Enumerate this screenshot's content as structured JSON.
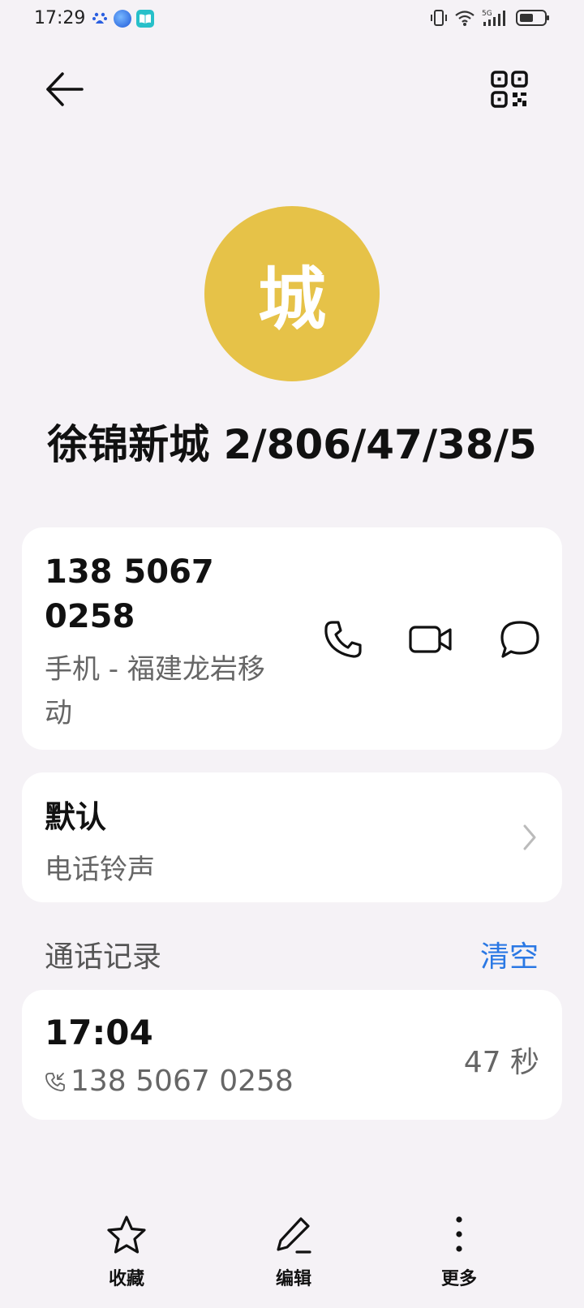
{
  "status_bar": {
    "time": "17:29",
    "app_icons": [
      "baidu-icon",
      "browser-icon",
      "book-icon"
    ],
    "right_icons": [
      "vibrate-icon",
      "wifi-icon",
      "signal-5g-icon",
      "battery-icon"
    ],
    "network_label": "5G"
  },
  "header": {
    "back_icon": "arrow-left-icon",
    "qr_icon": "qr-code-icon"
  },
  "contact": {
    "avatar_letter": "城",
    "avatar_color": "#e6c248",
    "name": "徐锦新城 2/806/47/38/5"
  },
  "phone_card": {
    "number": "138 5067 0258",
    "type_label": "手机 - 福建龙岩移动",
    "actions": [
      "phone-call-icon",
      "video-call-icon",
      "message-icon"
    ]
  },
  "ringtone_card": {
    "title": "默认",
    "subtitle": "电话铃声"
  },
  "call_log": {
    "section_title": "通话记录",
    "clear_label": "清空",
    "accent_color": "#2a78e4",
    "entries": [
      {
        "time": "17:04",
        "number": "138 5067 0258",
        "duration": "47 秒"
      }
    ]
  },
  "bottom_nav": {
    "items": [
      {
        "label": "收藏",
        "icon": "star-icon"
      },
      {
        "label": "编辑",
        "icon": "pencil-icon"
      },
      {
        "label": "更多",
        "icon": "more-vertical-icon"
      }
    ]
  }
}
